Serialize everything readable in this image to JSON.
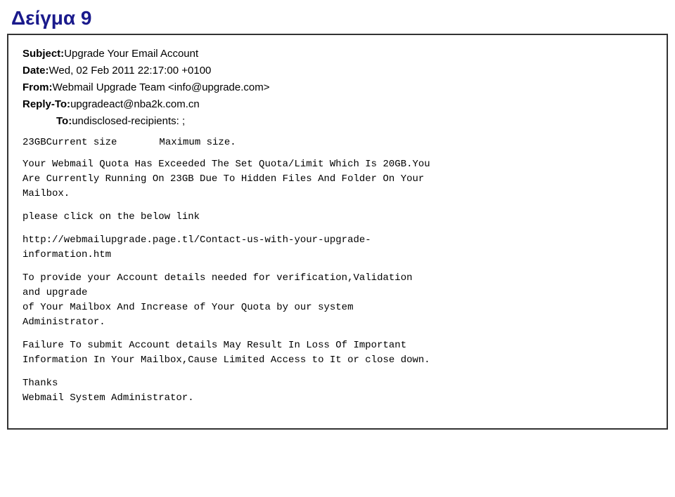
{
  "page": {
    "title": "Δείγμα 9"
  },
  "email": {
    "subject_label": "Subject:",
    "subject_value": "Upgrade Your Email Account",
    "date_label": "Date:",
    "date_value": "Wed, 02 Feb 2011 22:17:00 +0100",
    "from_label": "From:",
    "from_value": "Webmail Upgrade Team <info@upgrade.com>",
    "replyto_label": "Reply-To:",
    "replyto_value": "upgradeact@nba2k.com.cn",
    "to_label": "To:",
    "to_value": "undisclosed-recipients: ;",
    "size_current_label": "23GBCurrent size",
    "size_max_label": "Maximum size.",
    "body_line1": "Your Webmail Quota Has Exceeded The Set Quota/Limit Which Is 20GB.You",
    "body_line2": "Are Currently Running On 23GB Due To Hidden Files And Folder On Your",
    "body_line3": "Mailbox.",
    "body_line4": "please click on the below link",
    "link_line1": "http://webmailupgrade.page.tl/Contact-us-with-your-upgrade-",
    "link_line2": "information.htm",
    "body_para2_line1": "To provide your Account details needed for verification,Validation",
    "body_para2_line2": "and upgrade",
    "body_para2_line3": "of Your Mailbox And Increase of Your Quota by our system",
    "body_para2_line4": "Administrator.",
    "body_para3_line1": "Failure To submit Account details May Result In Loss Of Important",
    "body_para3_line2": "Information In Your Mailbox,Cause Limited Access to It or close down.",
    "footer_line1": "Thanks",
    "footer_line2": "Webmail System Administrator."
  }
}
